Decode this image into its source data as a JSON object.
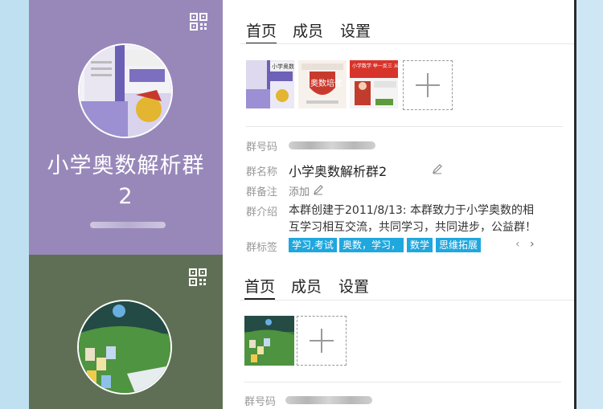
{
  "groups": [
    {
      "name_line1": "小学奥数解析群",
      "name_line2": "2",
      "tabs": [
        "首页",
        "成员",
        "设置"
      ],
      "fields": {
        "group_number_label": "群号码",
        "group_name_label": "群名称",
        "group_name_value": "小学奥数解析群2",
        "group_note_label": "群备注",
        "group_note_value": "添加",
        "group_intro_label": "群介绍",
        "group_intro_line1": "本群创建于2011/8/13:  本群致力于小学奥数的相",
        "group_intro_line2": "互学习相互交流，共同学习，共同进步，公益群！",
        "group_tags_label": "群标签",
        "tags": [
          "学习,考试",
          "奥数，学习，",
          "数学",
          "思维拓展"
        ]
      },
      "thumbnails": [
        {
          "title": "小学奥数 举一反三"
        },
        {
          "title": "奥数培优"
        },
        {
          "title": "小学数学 举一反三 从课本到奥赛"
        }
      ]
    },
    {
      "tabs": [
        "首页",
        "成员",
        "设置"
      ],
      "fields": {
        "group_number_label": "群号码"
      }
    }
  ],
  "icons": {
    "qr": "qr-code-icon",
    "edit": "pencil-icon",
    "prev": "chevron-left-icon",
    "next": "chevron-right-icon",
    "add": "plus-icon"
  },
  "colors": {
    "sidebar1": "#9888ba",
    "sidebar2": "#5f6f55",
    "tag": "#1fa7de"
  }
}
